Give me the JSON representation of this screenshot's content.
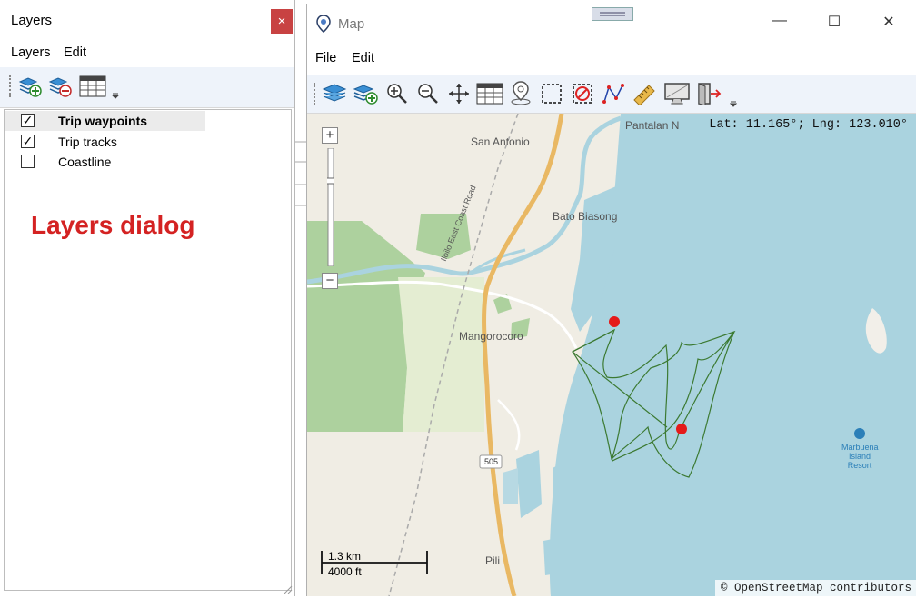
{
  "layers_window": {
    "title": "Layers",
    "close_glyph": "×",
    "menu": [
      "Layers",
      "Edit"
    ],
    "toolbar_icons": [
      "add-layer-icon",
      "remove-layer-icon",
      "attribute-table-icon",
      "overflow-arrow-icon"
    ],
    "layers": [
      {
        "label": "Trip waypoints",
        "checked": true,
        "bold": true,
        "selected": true
      },
      {
        "label": "Trip tracks",
        "checked": true,
        "bold": false,
        "selected": false
      },
      {
        "label": "Coastline",
        "checked": false,
        "bold": false,
        "selected": false
      }
    ],
    "annotation": "Layers dialog"
  },
  "map_window": {
    "title": "Map",
    "min_glyph": "—",
    "max_glyph": "☐",
    "close_glyph": "✕",
    "menu": [
      "File",
      "Edit"
    ],
    "toolbar_icons": [
      "layers-icon",
      "add-layer-icon",
      "zoom-in-icon",
      "zoom-out-icon",
      "pan-icon",
      "attribute-table-icon",
      "locate-icon",
      "select-box-icon",
      "clear-selection-icon",
      "draw-line-icon",
      "measure-icon",
      "screen-icon",
      "exit-icon",
      "overflow-arrow-icon"
    ],
    "coord_readout": "Lat: 11.165°; Lng: 123.010°",
    "zoom_in_glyph": "+",
    "zoom_out_glyph": "−",
    "scale": {
      "top": "1.3 km",
      "bottom": "4000 ft"
    },
    "attribution": "© OpenStreetMap contributors",
    "place_labels": [
      "San Antonio",
      "Pantalan N",
      "Bato Biasong",
      "Mangorocoro",
      "Pili",
      "Iloilo East Coast Road",
      "505",
      "Marbuena Island Resort"
    ],
    "colors": {
      "water": "#aad3df",
      "land": "#f2efe9",
      "forest": "#add19e",
      "road": "#e9b863",
      "track": "#3c7a32",
      "waypoint": "#e51a1a"
    }
  }
}
